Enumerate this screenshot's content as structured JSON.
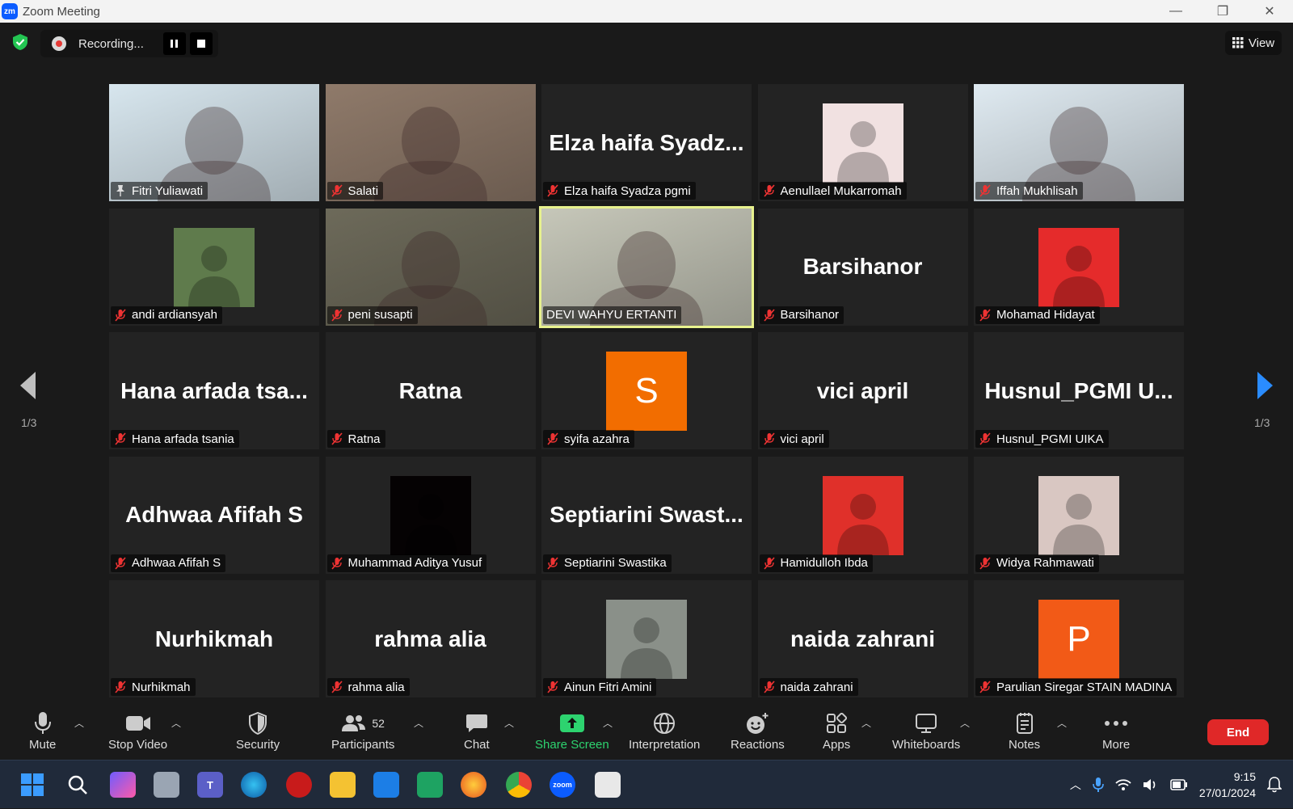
{
  "window": {
    "logo": "zm",
    "title": "Zoom Meeting",
    "controls": [
      "—",
      "❐",
      "✕"
    ]
  },
  "topbar": {
    "recording_label": "Recording...",
    "view_label": "View"
  },
  "tiles": [
    {
      "name": "Fitri Yuliawati",
      "kind": "photo",
      "bg": "#d7e6ee",
      "active": false,
      "pinned": true
    },
    {
      "name": "Salati",
      "kind": "photo",
      "bg": "#8f7a6a",
      "active": false
    },
    {
      "name": "Elza haifa Syadza pgmi",
      "kind": "text",
      "display": "Elza  haifa  Syadz...",
      "active": false
    },
    {
      "name": "Aenullael Mukarromah",
      "kind": "avatar",
      "bg": "#f1e1e1",
      "active": false
    },
    {
      "name": "Iffah Mukhlisah",
      "kind": "photo",
      "bg": "#dfeaf1",
      "active": false
    },
    {
      "name": "andi ardiansyah",
      "kind": "avatar",
      "bg": "#5f7b4c",
      "active": false
    },
    {
      "name": "peni susapti",
      "kind": "photo",
      "bg": "#6d6a5a",
      "active": false
    },
    {
      "name": "DEVI WAHYU ERTANTI",
      "kind": "photo",
      "bg": "#c6c7b9",
      "active": true
    },
    {
      "name": "Barsihanor",
      "kind": "text",
      "display": "Barsihanor",
      "active": false
    },
    {
      "name": "Mohamad Hidayat",
      "kind": "avatar",
      "bg": "#e52b2b",
      "active": false
    },
    {
      "name": "Hana arfada tsania",
      "kind": "text",
      "display": "Hana  arfada  tsa...",
      "active": false
    },
    {
      "name": "Ratna",
      "kind": "text",
      "display": "Ratna",
      "active": false
    },
    {
      "name": "syifa azahra",
      "kind": "letter",
      "letter": "S",
      "bg": "#f26d00",
      "active": false
    },
    {
      "name": "vici april",
      "kind": "text",
      "display": "vici april",
      "active": false
    },
    {
      "name": "Husnul_PGMI UIKA",
      "kind": "text",
      "display": "Husnul_PGMI  U...",
      "active": false
    },
    {
      "name": "Adhwaa Afifah S",
      "kind": "text",
      "display": "Adhwaa Afifah S",
      "active": false
    },
    {
      "name": "Muhammad Aditya Yusuf",
      "kind": "avatar",
      "bg": "#050203",
      "active": false
    },
    {
      "name": "Septiarini Swastika",
      "kind": "text",
      "display": "Septiarini  Swast...",
      "active": false
    },
    {
      "name": "Hamidulloh Ibda",
      "kind": "avatar",
      "bg": "#e0302a",
      "active": false
    },
    {
      "name": "Widya Rahmawati",
      "kind": "avatar",
      "bg": "#d9c7c2",
      "active": false
    },
    {
      "name": "Nurhikmah",
      "kind": "text",
      "display": "Nurhikmah",
      "active": false
    },
    {
      "name": "rahma alia",
      "kind": "text",
      "display": "rahma alia",
      "active": false
    },
    {
      "name": "Ainun Fitri Amini",
      "kind": "avatar",
      "bg": "#8a9089",
      "active": false
    },
    {
      "name": "naida zahrani",
      "kind": "text",
      "display": "naida zahrani",
      "active": false
    },
    {
      "name": "Parulian Siregar STAIN MADINA",
      "kind": "letter",
      "letter": "P",
      "bg": "#f25a17",
      "active": false
    }
  ],
  "pagination": {
    "left": "1/3",
    "right": "1/3"
  },
  "toolbar": {
    "mute": "Mute",
    "stop_video": "Stop Video",
    "security": "Security",
    "participants": "Participants",
    "participants_count": "52",
    "chat": "Chat",
    "share_screen": "Share Screen",
    "interpretation": "Interpretation",
    "reactions": "Reactions",
    "apps": "Apps",
    "whiteboards": "Whiteboards",
    "notes": "Notes",
    "more": "More",
    "end": "End"
  },
  "taskbar": {
    "time": "9:15",
    "date": "27/01/2024"
  },
  "colors": {
    "accent_green": "#2dd36f",
    "end_red": "#e02828",
    "active_speaker": "#e8f28e",
    "arrow_blue": "#2a8cff"
  }
}
